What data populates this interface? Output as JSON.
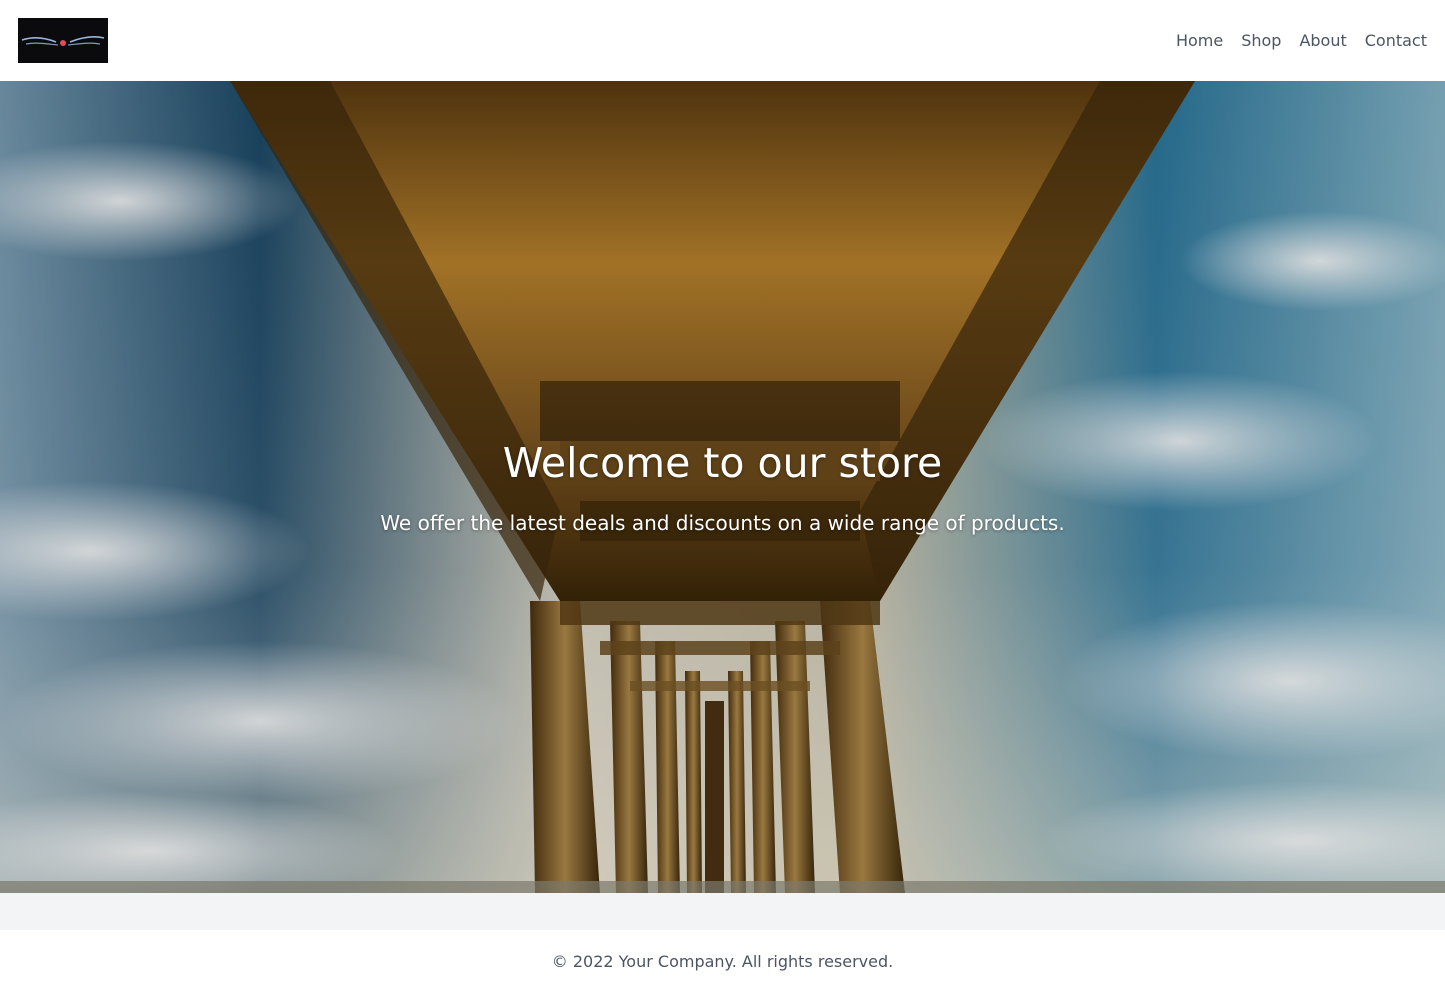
{
  "header": {
    "logo_alt": "Logo",
    "nav": [
      {
        "label": "Home"
      },
      {
        "label": "Shop"
      },
      {
        "label": "About"
      },
      {
        "label": "Contact"
      }
    ]
  },
  "hero": {
    "title": "Welcome to our store",
    "subtitle": "We offer the latest deals and discounts on a wide range of products."
  },
  "footer": {
    "copyright": "© 2022 Your Company. All rights reserved."
  },
  "colors": {
    "header_bg": "#ffffff",
    "nav_text": "#4b5563",
    "page_bg": "#f3f4f6",
    "hero_text": "#ffffff",
    "footer_text": "#4b5563"
  }
}
